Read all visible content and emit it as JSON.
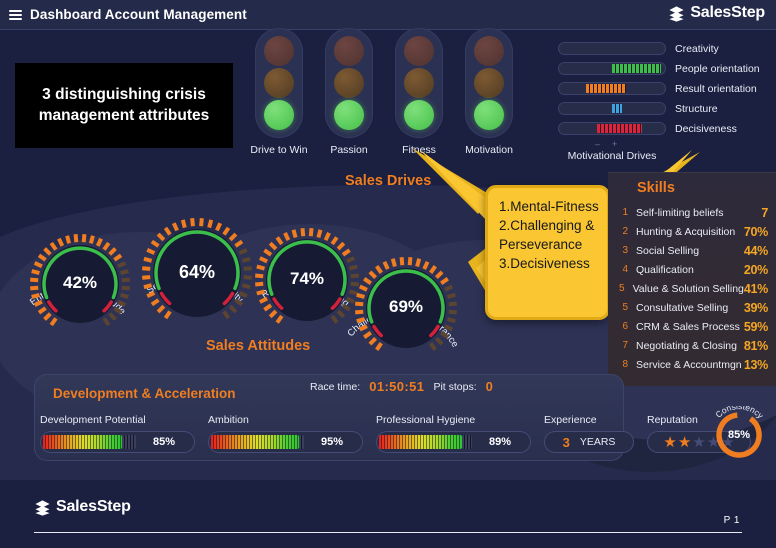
{
  "header": {
    "menu_icon": "hamburger-icon",
    "title": "Dashboard Account Management",
    "brand": "SalesStep",
    "brand_icon": "layers-icon"
  },
  "statement_box": {
    "text": "3 distinguishing crisis management attributes"
  },
  "sales_drives": {
    "heading": "Sales Drives",
    "lights": [
      {
        "label": "Drive to Win",
        "state": "green"
      },
      {
        "label": "Passion",
        "state": "green"
      },
      {
        "label": "Fitness",
        "state": "green"
      },
      {
        "label": "Motivation",
        "state": "green"
      }
    ]
  },
  "motivational_drives": {
    "caption": "Motivational Drives",
    "minus": "–",
    "plus": "+",
    "items": [
      {
        "label": "Creativity",
        "value": 0,
        "offset": 50,
        "color": "#9aa0c0"
      },
      {
        "label": "People orientation",
        "value": 45,
        "offset": 50,
        "color": "#3bbf4a"
      },
      {
        "label": "Result orientation",
        "value": 37,
        "offset": 26,
        "color": "#f07d20"
      },
      {
        "label": "Structure",
        "value": 9,
        "offset": 50,
        "color": "#3aa3e0"
      },
      {
        "label": "Decisiveness",
        "value": 42,
        "offset": 36,
        "color": "#e0233c"
      }
    ]
  },
  "sales_attitudes": {
    "heading": "Sales Attitudes",
    "gauges": [
      {
        "label": "Entrepreneurial Attitude",
        "value": "42%",
        "pct": 42
      },
      {
        "label": "Sense of Responsibility",
        "value": "64%",
        "pct": 64
      },
      {
        "label": "Relationship Building",
        "value": "74%",
        "pct": 74
      },
      {
        "label": "Challenging & Perseverance",
        "value": "69%",
        "pct": 69
      }
    ]
  },
  "callout": {
    "text": "1.Mental-Fitness 2.Challenging & Perseverance 3.Decisiveness"
  },
  "skills": {
    "heading": "Skills",
    "rows": [
      {
        "num": "1",
        "name": "Self-limiting beliefs",
        "value": "7"
      },
      {
        "num": "2",
        "name": "Hunting & Acquisition",
        "value": "70%"
      },
      {
        "num": "3",
        "name": "Social Selling",
        "value": "44%"
      },
      {
        "num": "4",
        "name": "Qualification",
        "value": "20%"
      },
      {
        "num": "5",
        "name": "Value & Solution Selling",
        "value": "41%"
      },
      {
        "num": "5",
        "name": "Consultative Selling",
        "value": "39%"
      },
      {
        "num": "6",
        "name": "CRM & Sales Process",
        "value": "59%"
      },
      {
        "num": "7",
        "name": "Negotiating & Closing",
        "value": "81%"
      },
      {
        "num": "8",
        "name": "Service & Accountmgn",
        "value": "13%"
      }
    ]
  },
  "development": {
    "heading": "Development & Acceleration",
    "race_time_label": "Race time:",
    "race_time_value": "01:50:51",
    "pit_stops_label": "Pit stops:",
    "pit_stops_value": "0",
    "bars": [
      {
        "label": "Development Potential",
        "value": "85%",
        "pct": 85
      },
      {
        "label": "Ambition",
        "value": "95%",
        "pct": 95
      },
      {
        "label": "Professional Hygiene",
        "value": "89%",
        "pct": 89
      }
    ],
    "experience": {
      "label": "Experience",
      "value": "3",
      "unit": "YEARS"
    },
    "reputation": {
      "label": "Reputation",
      "filled": 2,
      "total": 5
    },
    "consistency": {
      "label": "Consistency",
      "value": "85%",
      "pct": 85
    }
  },
  "footer": {
    "brand": "SalesStep",
    "brand_icon": "layers-icon",
    "page": "P 1"
  },
  "colors": {
    "accent_orange": "#f07d20",
    "callout_yellow": "#fac732",
    "bg": "#1b2040"
  }
}
